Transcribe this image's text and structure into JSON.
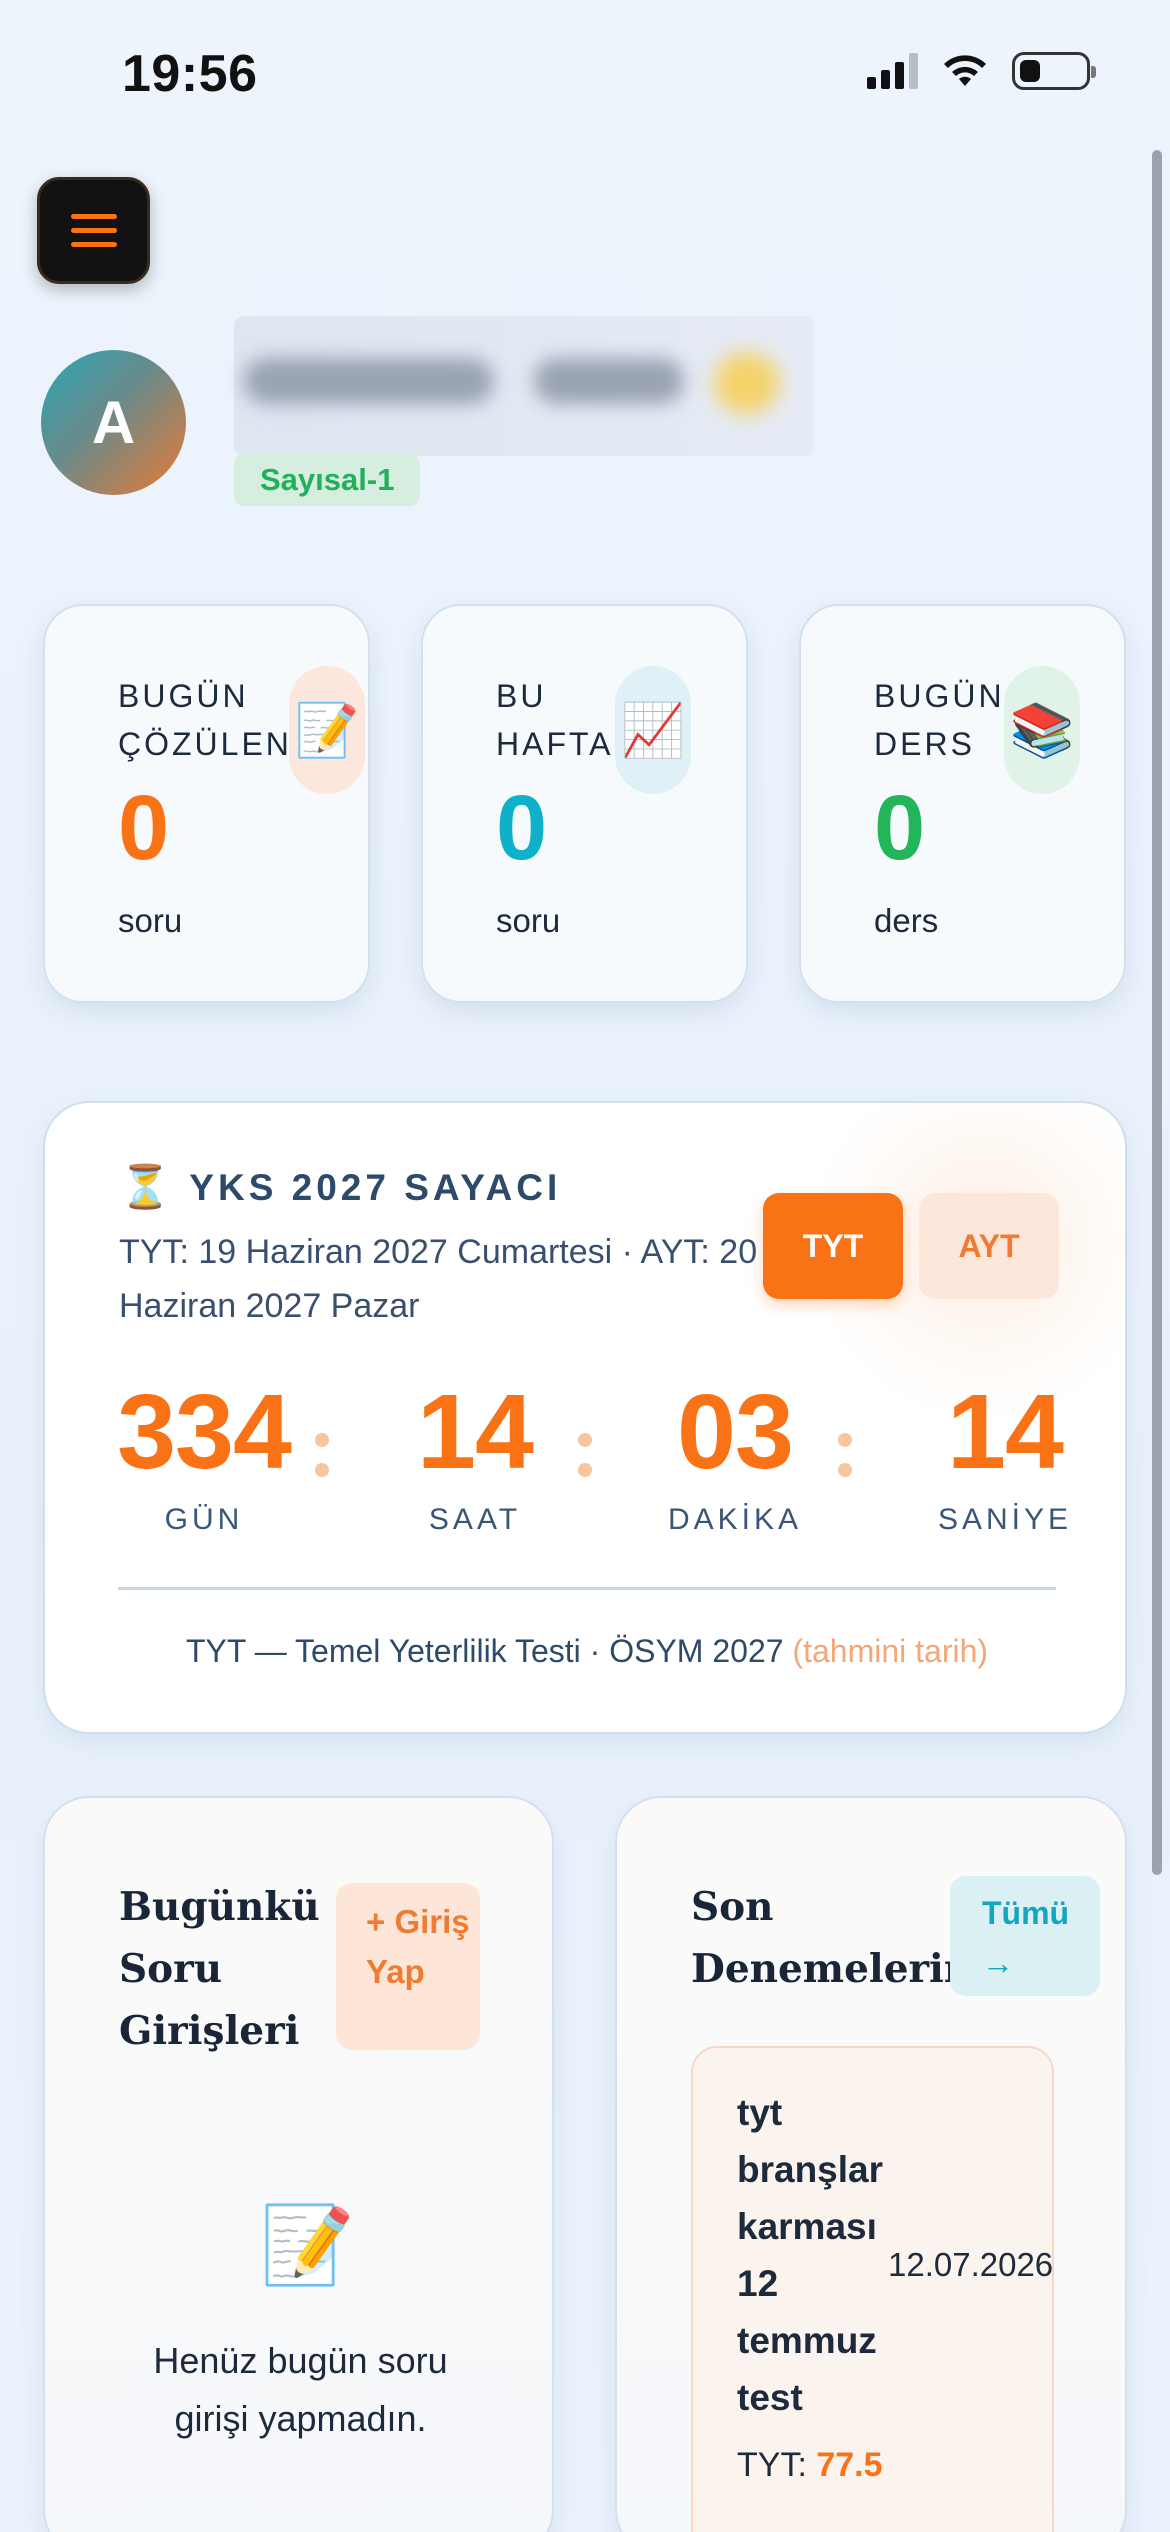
{
  "status_bar": {
    "time": "19:56"
  },
  "profile": {
    "avatar_initial": "A",
    "track": "Sayısal-1"
  },
  "stats": [
    {
      "label": "BUGÜN ÇÖZÜLEN",
      "icon": "memo-icon",
      "value": "0",
      "unit": "soru",
      "color": "#f97316"
    },
    {
      "label": "BU HAFTA",
      "icon": "chart-increasing-icon",
      "value": "0",
      "unit": "soru",
      "color": "#0fb0c9"
    },
    {
      "label": "BUGÜN DERS",
      "icon": "books-icon",
      "value": "0",
      "unit": "ders",
      "color": "#22b559"
    }
  ],
  "countdown": {
    "title": "YKS 2027 SAYACI",
    "subtitle": "TYT: 19 Haziran 2027 Cumartesi · AYT: 20 Haziran 2027 Pazar",
    "tabs": [
      {
        "label": "TYT",
        "active": true
      },
      {
        "label": "AYT",
        "active": false
      }
    ],
    "units": [
      {
        "value": "334",
        "caption": "GÜN"
      },
      {
        "value": "14",
        "caption": "SAAT"
      },
      {
        "value": "03",
        "caption": "DAKİKA"
      },
      {
        "value": "14",
        "caption": "SANİYE"
      }
    ],
    "footer": "TYT — Temel Yeterlilik Testi · ÖSYM 2027",
    "footer_note": "(tahmini tarih)"
  },
  "today_entries": {
    "title": "Bugünkü Soru Girişleri",
    "button": "+ Giriş Yap",
    "empty_text": "Henüz bugün soru girişi yapmadın."
  },
  "recent_exams": {
    "title": "Son Denemelerim",
    "button": "Tümü →",
    "items": [
      {
        "name": "tyt branşlar karması 12 temmuz test",
        "date": "12.07.2026",
        "score_label": "TYT:",
        "score": "77.5"
      }
    ]
  },
  "colors": {
    "accent": "#f97316",
    "cyan": "#0fb0c9",
    "green": "#22b559",
    "background": "#eaf2fb"
  }
}
